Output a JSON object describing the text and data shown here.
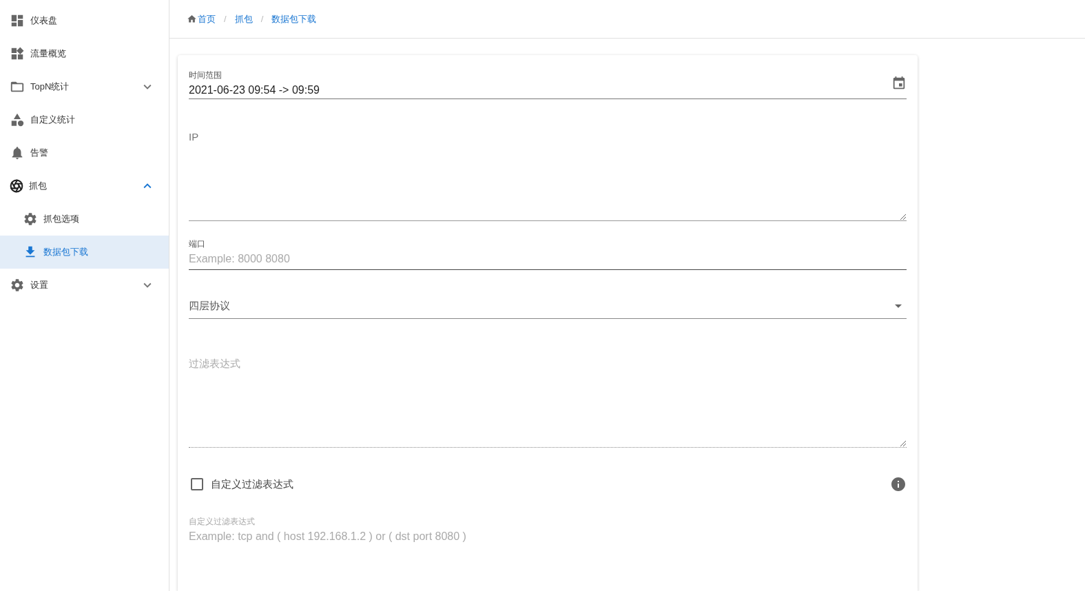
{
  "sidebar": {
    "items": [
      {
        "label": "仪表盘",
        "selected": false
      },
      {
        "label": "流量概览",
        "selected": false
      },
      {
        "label": "TopN统计",
        "selected": false,
        "expanded": false
      },
      {
        "label": "自定义统计",
        "selected": false
      },
      {
        "label": "告警",
        "selected": false
      },
      {
        "label": "抓包",
        "selected": false,
        "expanded": true,
        "children": [
          {
            "label": "抓包选项",
            "selected": false
          },
          {
            "label": "数据包下载",
            "selected": true
          }
        ]
      },
      {
        "label": "设置",
        "selected": false,
        "expanded": false
      }
    ]
  },
  "breadcrumb": {
    "separator": "/",
    "items": [
      "首页",
      "抓包",
      "数据包下载"
    ]
  },
  "form": {
    "fields": [
      {
        "kind": "date",
        "label": "时间范围",
        "value": "2021-06-23 09:54 -> 09:59"
      },
      {
        "kind": "textarea",
        "label": "IP",
        "disabled": false
      },
      {
        "kind": "text",
        "label": "端口",
        "placeholder": "Example: 8000 8080",
        "disabled": false
      },
      {
        "kind": "select",
        "label": "四层协议"
      },
      {
        "kind": "textarea",
        "label": "过滤表达式",
        "disabled": true
      },
      {
        "kind": "checkbox",
        "label": "自定义过滤表达式",
        "checked": false
      },
      {
        "kind": "text",
        "label": "自定义过滤表达式",
        "placeholder": "Example: tcp and ( host 192.168.1.2 ) or ( dst port 8080 )",
        "disabled": true
      }
    ]
  }
}
